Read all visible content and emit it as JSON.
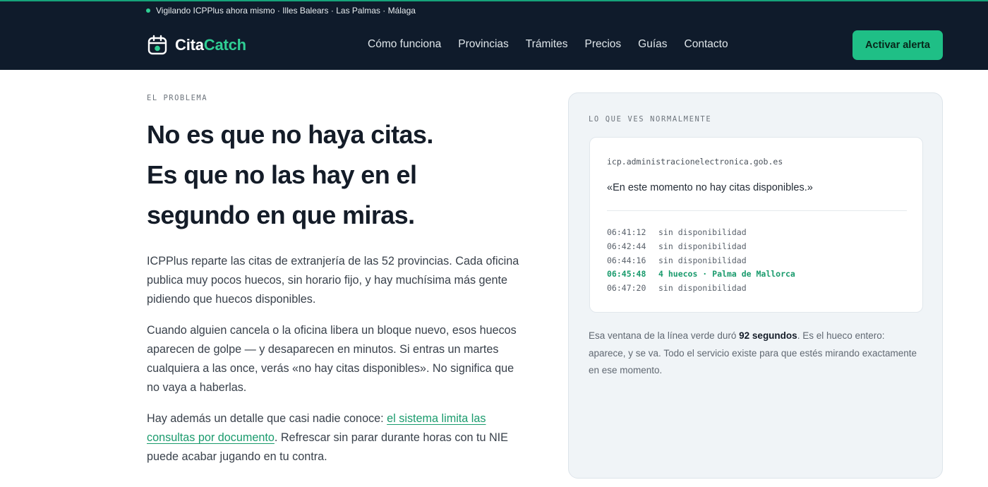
{
  "topbar": {
    "status": "Vigilando ICPPlus ahora mismo · Illes Balears · Las Palmas · Málaga",
    "accent": "#2fcf94"
  },
  "header": {
    "logo_icon": "calendar-icon",
    "logo_part1": "Cita",
    "logo_part2": "Catch",
    "nav": [
      "Cómo funciona",
      "Provincias",
      "Trámites",
      "Precios",
      "Guías",
      "Contacto"
    ],
    "cta_label": "Activar alerta",
    "bg_color": "#0f1b2b",
    "cta_color": "#1fbf86"
  },
  "main": {
    "kicker": "EL PROBLEMA",
    "headline": [
      "No es que no haya citas.",
      "Es que no las hay en el",
      "segundo en que miras."
    ],
    "p1": "ICPPlus reparte las citas de extranjería de las 52 provincias. Cada oficina publica muy pocos huecos, sin horario fijo, y hay muchísima más gente pidiendo que huecos disponibles.",
    "p2": "Cuando alguien cancela o la oficina libera un bloque nuevo, esos huecos aparecen de golpe — y desaparecen en minutos. Si entras un martes cualquiera a las once, verás «no hay citas disponibles». No significa que no vaya a haberlas.",
    "p3_before": "Hay además un detalle que casi nadie conoce: ",
    "p3_link": "el sistema limita las consultas por documento",
    "p3_after": ". Refrescar sin parar durante horas con tu NIE puede acabar jugando en tu contra."
  },
  "panel": {
    "kicker": "LO QUE VES NORMALMENTE",
    "url": "icp.administracionelectronica.gob.es",
    "message": "«En este momento no hay citas disponibles.»",
    "log": [
      {
        "time": "06:41:12",
        "text": "sin disponibilidad",
        "highlight": false
      },
      {
        "time": "06:42:44",
        "text": "sin disponibilidad",
        "highlight": false
      },
      {
        "time": "06:44:16",
        "text": "sin disponibilidad",
        "highlight": false
      },
      {
        "time": "06:45:48",
        "text": "4 huecos · Palma de Mallorca",
        "highlight": true
      },
      {
        "time": "06:47:20",
        "text": "sin disponibilidad",
        "highlight": false
      }
    ],
    "note_before": "Esa ventana de la línea verde duró ",
    "note_bold": "92 segundos",
    "note_after": ". Es el hueco entero: aparece, y se va. Todo el servicio existe para que estés mirando exactamente en ese momento.",
    "highlight_color": "#1a9b6d"
  }
}
